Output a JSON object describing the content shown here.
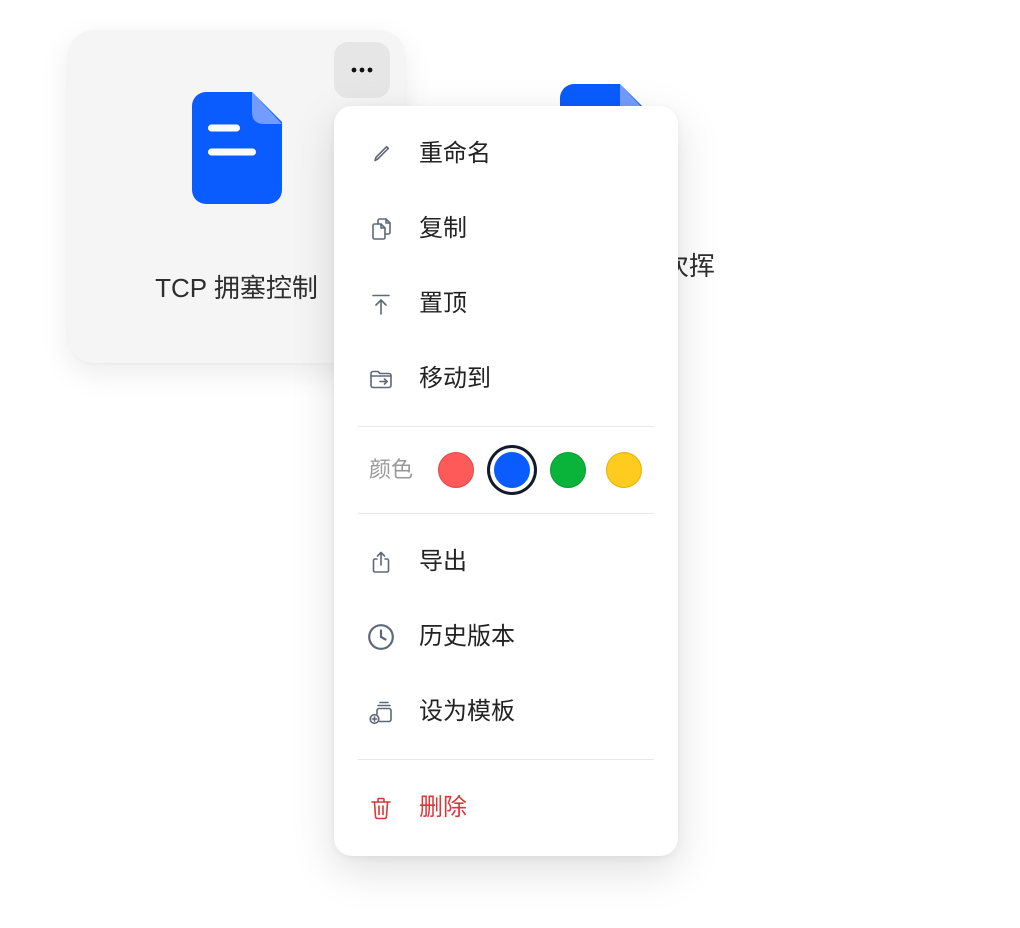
{
  "theme": {
    "accent": "#0a5cff",
    "accent_light": "#729dff",
    "card_bg": "#f5f5f5",
    "text": "#222222",
    "muted": "#9a9a9a",
    "icon": "#5f6878",
    "danger": "#d9383a"
  },
  "files": [
    {
      "title": "TCP 拥塞控制",
      "icon": "document-icon"
    },
    {
      "title": "次挥",
      "icon": "document-icon"
    }
  ],
  "more_button": {
    "icon": "more-horizontal-icon"
  },
  "context_menu": {
    "items": [
      {
        "label": "重命名",
        "icon": "pencil-icon"
      },
      {
        "label": "复制",
        "icon": "copy-icon"
      },
      {
        "label": "置顶",
        "icon": "pin-to-top-icon"
      },
      {
        "label": "移动到",
        "icon": "folder-move-icon"
      }
    ],
    "color_picker": {
      "label": "颜色",
      "swatches": [
        {
          "hex": "#ff5a5a",
          "border": "#e24848",
          "selected": false
        },
        {
          "hex": "#0a5cff",
          "border": "#0a5cff",
          "selected": true
        },
        {
          "hex": "#0ab43a",
          "border": "#079a30",
          "selected": false
        },
        {
          "hex": "#ffcb1f",
          "border": "#e8b200",
          "selected": false
        }
      ]
    },
    "items_secondary": [
      {
        "label": "导出",
        "icon": "export-icon"
      },
      {
        "label": "历史版本",
        "icon": "clock-icon"
      },
      {
        "label": "设为模板",
        "icon": "template-icon"
      }
    ],
    "danger_item": {
      "label": "删除",
      "icon": "trash-icon"
    }
  }
}
